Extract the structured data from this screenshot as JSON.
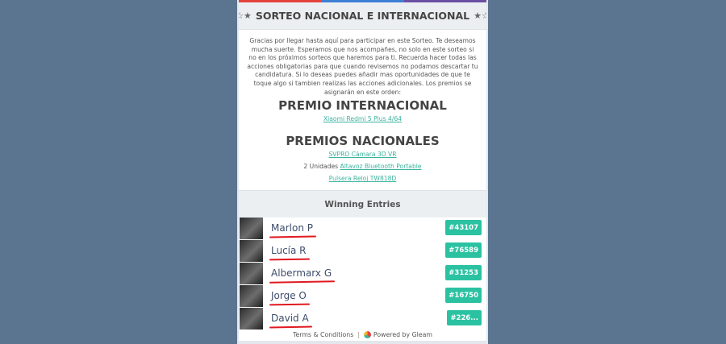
{
  "header": {
    "title": "SORTEO NACIONAL E INTERNACIONAL",
    "star_left": "☆★",
    "star_right": "★☆",
    "topbar_colors": [
      "#e4433d",
      "#3b7fd6",
      "#6a4fa3"
    ]
  },
  "description": "Gracias por llegar hasta aquí para participar en este Sorteo. Te deseamos mucha suerte. Esperamos que nos acompañes, no solo en este sorteo si no en los próximos sorteos que haremos para ti. Recuerda hacer todas las acciones obligatorias para que cuando revisemos no podamos descartar tu candidatura. Si lo deseas puedes añadir mas oportunidades de que te toque algo si tambien realizas las acciones adicionales. Los premios se asignarán en este orden:",
  "international": {
    "heading": "PREMIO INTERNACIONAL",
    "item": "Xiaomi Redmi 5 Plus 4/64"
  },
  "national": {
    "heading": "PREMIOS NACIONALES",
    "item1": "SVPRO Cámara 3D VR",
    "item2_prefix": "2 Unidades",
    "item2_link": "Altavoz Bluetooth Portable",
    "item3": "Pulsera Reloj TW818D"
  },
  "winners": {
    "heading": "Winning Entries",
    "entries": [
      {
        "name": "Marlon P",
        "entry": "#43107"
      },
      {
        "name": "Lucía R",
        "entry": "#76589"
      },
      {
        "name": "Albermarx G",
        "entry": "#31253"
      },
      {
        "name": "Jorge O",
        "entry": "#16750"
      },
      {
        "name": "David A",
        "entry": "#226..."
      }
    ]
  },
  "footer": {
    "terms": "Terms & Conditions",
    "separator": "|",
    "powered": "Powered by Gleam",
    "logo_icon": "gleam-logo-icon"
  },
  "colors": {
    "page_bg": "#5b7590",
    "accent": "#2bc2a2",
    "link": "#3bb39e",
    "underline": "#e0191f"
  }
}
